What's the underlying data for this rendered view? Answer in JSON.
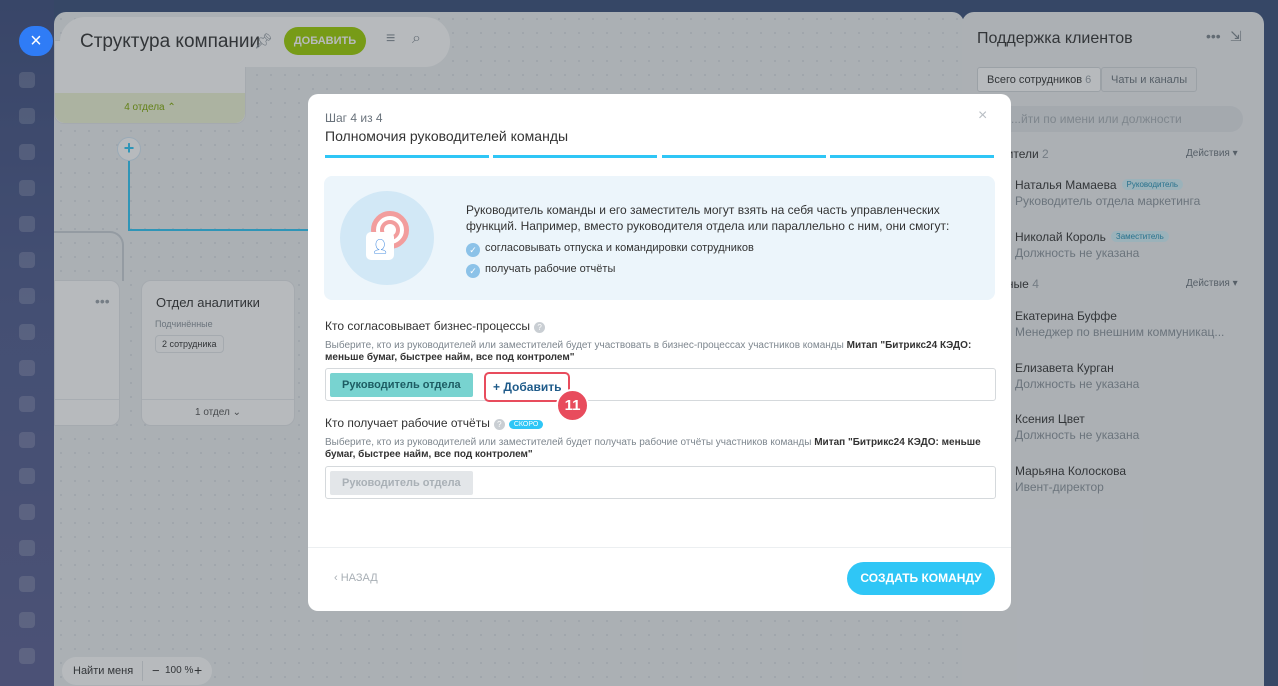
{
  "close_button": "×",
  "topbar": {
    "title": "Структура компании",
    "add_label": "ДОБАВИТЬ"
  },
  "org_chart": {
    "top_node_footer": "4 отдела ⌃",
    "card_title": "Отдел аналитики",
    "card_sub": "Подчинённые",
    "card_badge": "2 сотрудника",
    "card_footer": "1 отдел ⌄"
  },
  "zoom": {
    "find_me": "Найти меня",
    "percent": "100 %"
  },
  "support_panel": {
    "title": "Поддержка клиентов",
    "tab_all": "Всего сотрудников",
    "tab_all_count": "6",
    "tab_chats": "Чаты и каналы",
    "search_placeholder": "...йти по имени или должности",
    "section1": "...водители",
    "section1_count": "2",
    "section2": "...нённые",
    "section2_count": "4",
    "action_label": "Действия ▾",
    "people": [
      {
        "name": "Наталья Мамаева",
        "tag": "Руководитель",
        "role": "Руководитель отдела маркетинга"
      },
      {
        "name": "Николай Король",
        "tag": "Заместитель",
        "role": "Должность не указана"
      },
      {
        "name": "Екатерина Буффе",
        "tag": "",
        "role": "Менеджер по внешним коммуникац..."
      },
      {
        "name": "Елизавета Курган",
        "tag": "",
        "role": "Должность не указана"
      },
      {
        "name": "Ксения Цвет",
        "tag": "",
        "role": "Должность не указана"
      },
      {
        "name": "Марьяна Колоскова",
        "tag": "",
        "role": "Ивент-директор"
      }
    ]
  },
  "modal": {
    "step": "Шаг 4 из 4",
    "title": "Полномочия руководителей команды",
    "close": "×",
    "progress_steps": 4,
    "info_text": "Руководитель команды и его заместитель могут взять на себя часть управленческих функций. Например, вместо руководителя отдела или параллельно с ним, они смогут:",
    "info_items": [
      "согласовывать отпуска и командировки сотрудников",
      "получать рабочие отчёты"
    ],
    "q1_label": "Кто согласовывает бизнес-процессы",
    "q1_desc_prefix": "Выберите, кто из руководителей или заместителей будет участвовать в бизнес-процессах участников команды ",
    "q1_desc_bold": "Митап \"Битрикс24 КЭДО: меньше бумаг, быстрее найм, все под контролем\"",
    "q1_chip": "Руководитель отдела",
    "q1_add": "+ Добавить",
    "step_badge": "11",
    "q2_label": "Кто получает рабочие отчёты",
    "q2_soon": "СКОРО",
    "q2_desc_prefix": "Выберите, кто из руководителей или заместителей будет получать рабочие отчёты участников команды ",
    "q2_desc_bold": "Митап \"Битрикс24 КЭДО: меньше бумаг, быстрее найм, все под контролем\"",
    "q2_chip": "Руководитель отдела",
    "back": "‹ НАЗАД",
    "create": "СОЗДАТЬ КОМАНДУ"
  },
  "colors": {
    "accent": "#2fc6f6",
    "add_green": "#9dcf00",
    "highlight_red": "#e84c5d"
  }
}
